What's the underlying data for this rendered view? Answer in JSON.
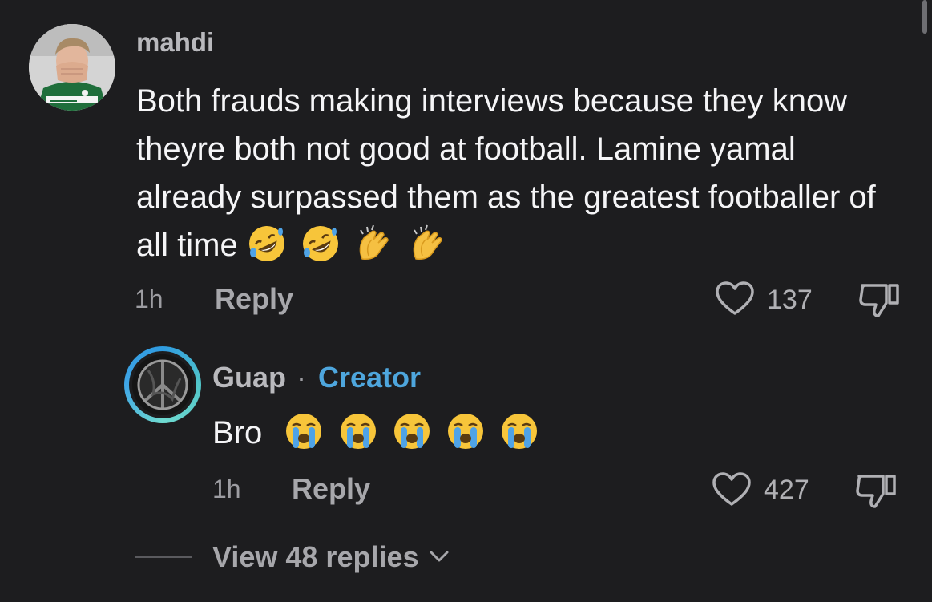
{
  "comment": {
    "username": "mahdi",
    "avatar_icon": "profile-photo",
    "text": "Both frauds making interviews because they know theyre both not good at football. Lamine yamal already surpassed them as the greatest footballer of all time",
    "emojis": [
      "rolling-on-floor-laughing",
      "rolling-on-floor-laughing",
      "clapping-hands",
      "clapping-hands"
    ],
    "time": "1h",
    "reply_label": "Reply",
    "like_count": "137"
  },
  "reply": {
    "username": "Guap",
    "separator": "·",
    "badge": "Creator",
    "text": "Bro",
    "emojis": [
      "loudly-crying-face",
      "loudly-crying-face",
      "loudly-crying-face",
      "loudly-crying-face",
      "loudly-crying-face"
    ],
    "time": "1h",
    "reply_label": "Reply",
    "like_count": "427"
  },
  "view_replies": {
    "label": "View 48 replies",
    "icon": "chevron-down-icon"
  },
  "colors": {
    "background": "#1d1d1f",
    "creator_badge": "#4ea6dd",
    "avatar_ring": "#52c6c9"
  }
}
